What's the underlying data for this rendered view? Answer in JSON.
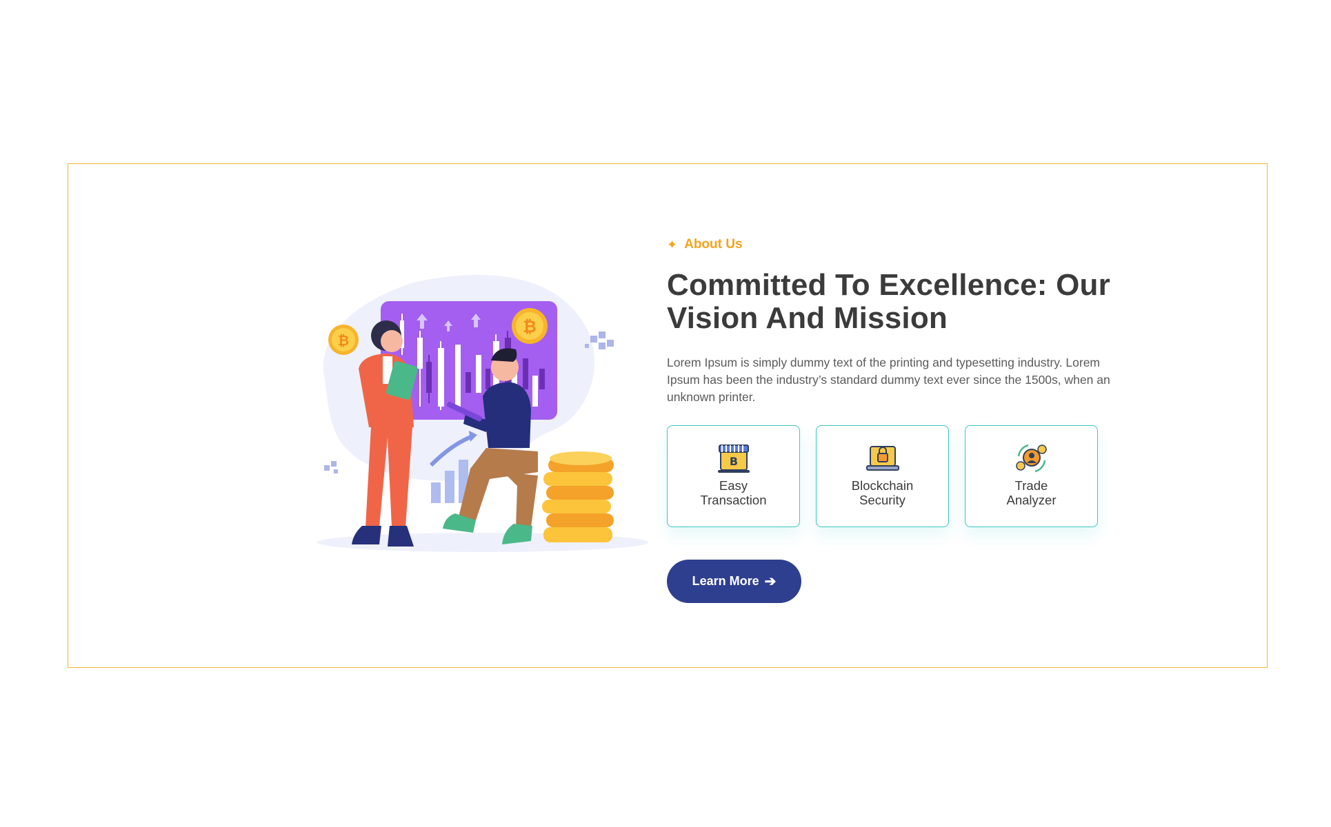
{
  "about": {
    "eyebrow": "About Us",
    "title_line1": "Committed To Excellence: Our",
    "title_line2": "Vision And Mission",
    "description": "Lorem Ipsum is simply dummy text of the printing and typesetting industry. Lorem Ipsum has been the industry’s standard dummy text ever since the 1500s, when an unknown printer.",
    "features": [
      {
        "label": "Easy\nTransaction",
        "icon": "bitcoin-shop-icon"
      },
      {
        "label": "Blockchain\nSecurity",
        "icon": "laptop-lock-icon"
      },
      {
        "label": "Trade\nAnalyzer",
        "icon": "exchange-coins-icon"
      }
    ],
    "button_label": "Learn More",
    "button_icon": "arrow-right-icon"
  },
  "colors": {
    "frame": "#f5b336",
    "accent": "#f5a21b",
    "card_border": "#3cc6c4",
    "button": "#2f3f8f"
  }
}
